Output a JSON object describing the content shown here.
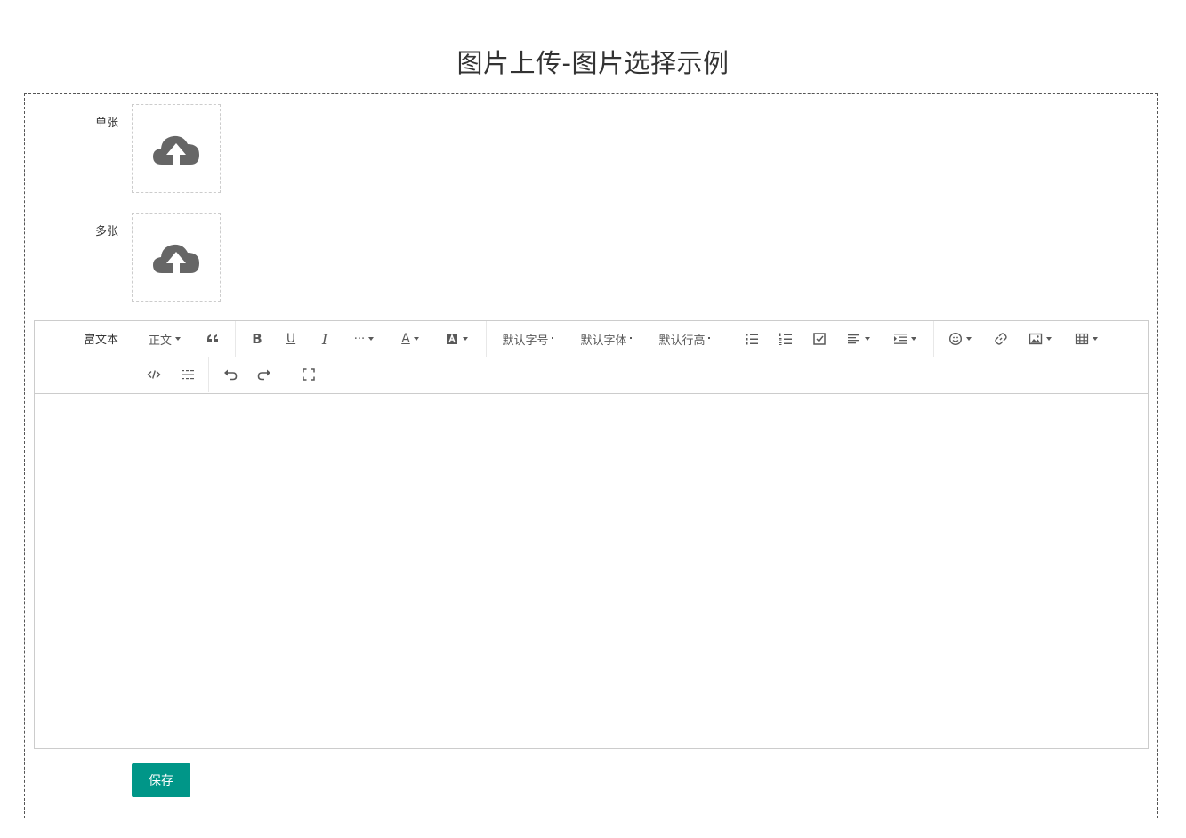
{
  "page_title": "图片上传-图片选择示例",
  "fields": {
    "single_label": "单张",
    "multi_label": "多张",
    "rich_label": "富文本"
  },
  "toolbar": {
    "heading": "正文",
    "font_size": "默认字号",
    "font_family": "默认字体",
    "line_height": "默认行高",
    "bold": "B",
    "underline": "U",
    "italic": "I",
    "more": "···",
    "font_color": "A"
  },
  "save_button": "保存",
  "colors": {
    "accent": "#009688",
    "icon": "#595959"
  }
}
